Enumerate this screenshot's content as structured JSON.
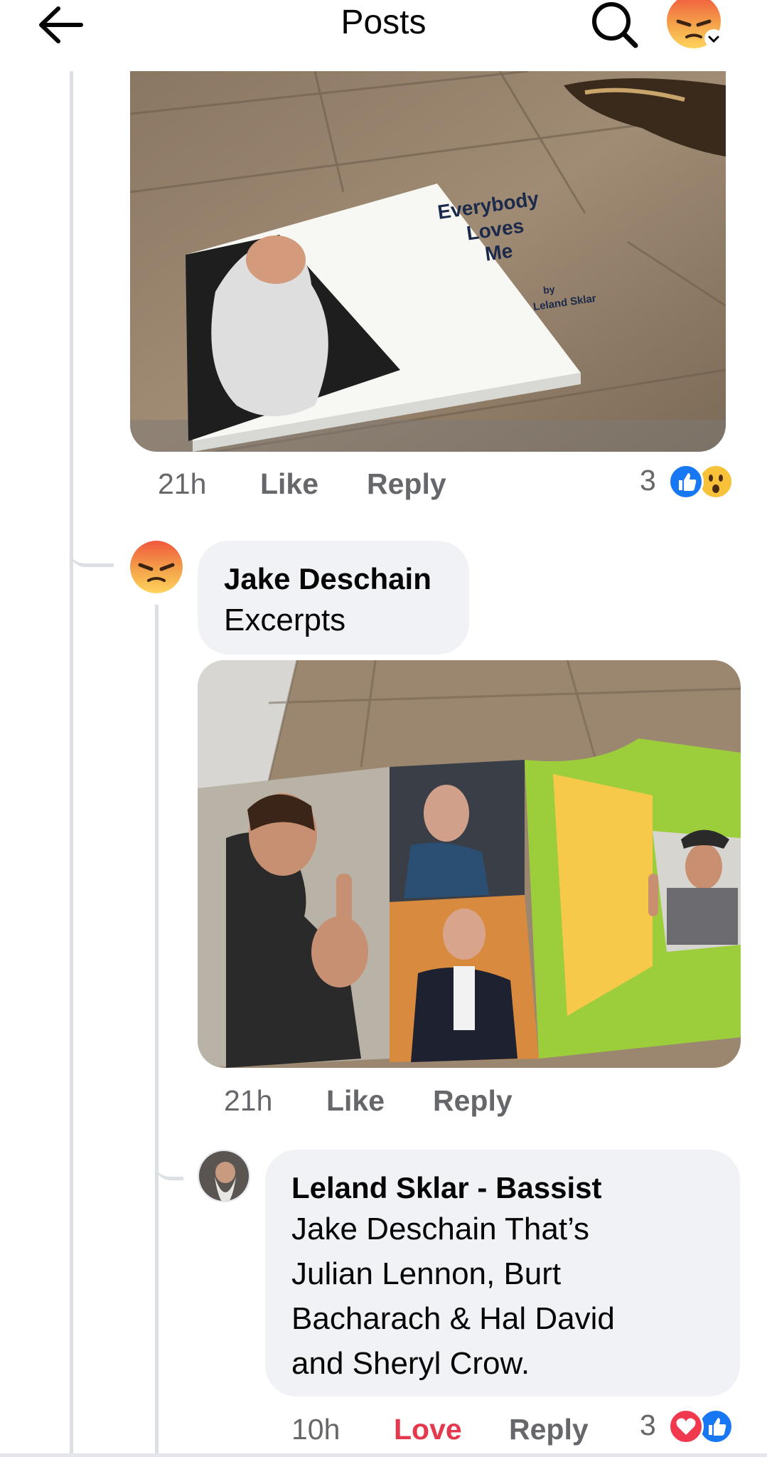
{
  "header": {
    "title": "Posts",
    "back_icon": "arrow-left-icon",
    "search_icon": "search-icon",
    "profile_icon": "angry-emoji-icon"
  },
  "photo1": {
    "book_title_line1": "Everybody",
    "book_title_line2": "Loves",
    "book_title_line3": "Me",
    "book_by": "by",
    "book_author": "Leland Sklar"
  },
  "comment1_meta": {
    "time": "21h",
    "like": "Like",
    "reply": "Reply",
    "reaction_count": "3",
    "reactions": [
      "like",
      "wow"
    ]
  },
  "comment2": {
    "author": "Jake Deschain",
    "text": "Excerpts",
    "time": "21h",
    "like": "Like",
    "reply": "Reply"
  },
  "comment3": {
    "author": "Leland Sklar - Bassist",
    "text": "Jake Deschain That’s\nJulian Lennon, Burt\nBacharach & Hal David\nand Sheryl Crow.",
    "time": "10h",
    "love": "Love",
    "reply": "Reply",
    "reaction_count": "3",
    "reactions": [
      "love",
      "like"
    ]
  },
  "colors": {
    "like_blue": "#1877f2",
    "love_red": "#e4384f",
    "meta_gray": "#65676b",
    "bubble_bg": "#f0f2f5"
  }
}
